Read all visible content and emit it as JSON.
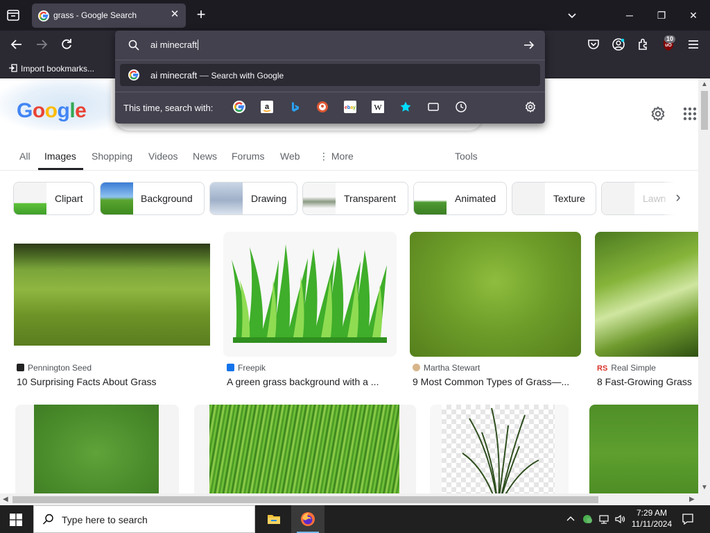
{
  "browser": {
    "tab_title": "grass - Google Search",
    "bookmark_label": "Import bookmarks...",
    "extension_badge": "10"
  },
  "urlbar": {
    "query": "ai minecraft",
    "suggestion_text": "ai minecraft",
    "suggestion_dash": "—",
    "suggestion_action": "Search with Google",
    "oneoff_label": "This time, search with:",
    "oneoff_engines": [
      "Google",
      "Amazon",
      "Bing",
      "DuckDuckGo",
      "eBay",
      "Wikipedia",
      "Bookmarks",
      "Tabs",
      "History"
    ]
  },
  "google": {
    "logo_letters": [
      "G",
      "o",
      "o",
      "g",
      "l",
      "e"
    ],
    "logo_colors": [
      "#4285f4",
      "#ea4335",
      "#fbbc05",
      "#4285f4",
      "#34a853",
      "#ea4335"
    ],
    "nav": [
      "All",
      "Images",
      "Shopping",
      "Videos",
      "News",
      "Forums",
      "Web",
      "More",
      "Tools"
    ],
    "active_nav": "Images",
    "chips": [
      "Clipart",
      "Background",
      "Drawing",
      "Transparent",
      "Animated",
      "Texture",
      "Lawn"
    ],
    "results": [
      {
        "source": "Pennington Seed",
        "title": "10 Surprising Facts About Grass"
      },
      {
        "source": "Freepik",
        "title": "A green grass background with a ..."
      },
      {
        "source": "Martha Stewart",
        "title": "9 Most Common Types of Grass—..."
      },
      {
        "source": "Real Simple",
        "title": "8 Fast-Growing Grass"
      }
    ]
  },
  "taskbar": {
    "search_placeholder": "Type here to search",
    "time": "7:29 AM",
    "date": "11/11/2024"
  }
}
